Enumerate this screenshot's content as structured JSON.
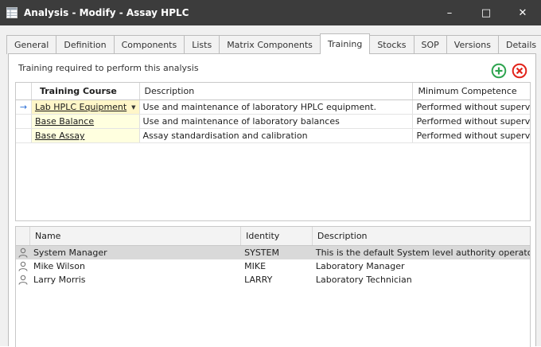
{
  "window": {
    "title": "Analysis - Modify - Assay HPLC",
    "minimize_label": "–",
    "maximize_label": "□",
    "close_label": "✕"
  },
  "tabs": [
    {
      "label": "General"
    },
    {
      "label": "Definition"
    },
    {
      "label": "Components"
    },
    {
      "label": "Lists"
    },
    {
      "label": "Matrix Components"
    },
    {
      "label": "Training",
      "active": true
    },
    {
      "label": "Stocks"
    },
    {
      "label": "SOP"
    },
    {
      "label": "Versions"
    },
    {
      "label": "Details"
    }
  ],
  "training": {
    "caption": "Training required to perform this analysis",
    "columns": {
      "course": "Training Course",
      "description": "Description",
      "competence": "Minimum Competence"
    },
    "rows": [
      {
        "course": "Lab HPLC Equipment",
        "description": "Use and maintenance of laboratory HPLC equipment.",
        "competence": "Performed without superv..."
      },
      {
        "course": "Base Balance",
        "description": "Use and maintenance of laboratory balances",
        "competence": "Performed without superv..."
      },
      {
        "course": "Base Assay",
        "description": "Assay standardisation and calibration",
        "competence": "Performed without superv..."
      }
    ],
    "row_indicator": "→",
    "dropdown_glyph": "▼"
  },
  "users": {
    "columns": {
      "name": "Name",
      "identity": "Identity",
      "description": "Description"
    },
    "rows": [
      {
        "name": "System Manager",
        "identity": "SYSTEM",
        "description": "This is the default System level authority operator"
      },
      {
        "name": "Mike Wilson",
        "identity": "MIKE",
        "description": "Laboratory Manager"
      },
      {
        "name": "Larry Morris",
        "identity": "LARRY",
        "description": "Laboratory Technician"
      }
    ]
  },
  "colors": {
    "titlebar": "#3c3c3c",
    "add": "#2ea44f",
    "remove": "#e2231a",
    "row_highlight": "#d9d9d9",
    "course_cell": "#ffffdf"
  },
  "icons": {
    "app": "grid-icon",
    "add": "add-circle-icon",
    "remove": "remove-circle-icon",
    "user": "user-icon"
  }
}
